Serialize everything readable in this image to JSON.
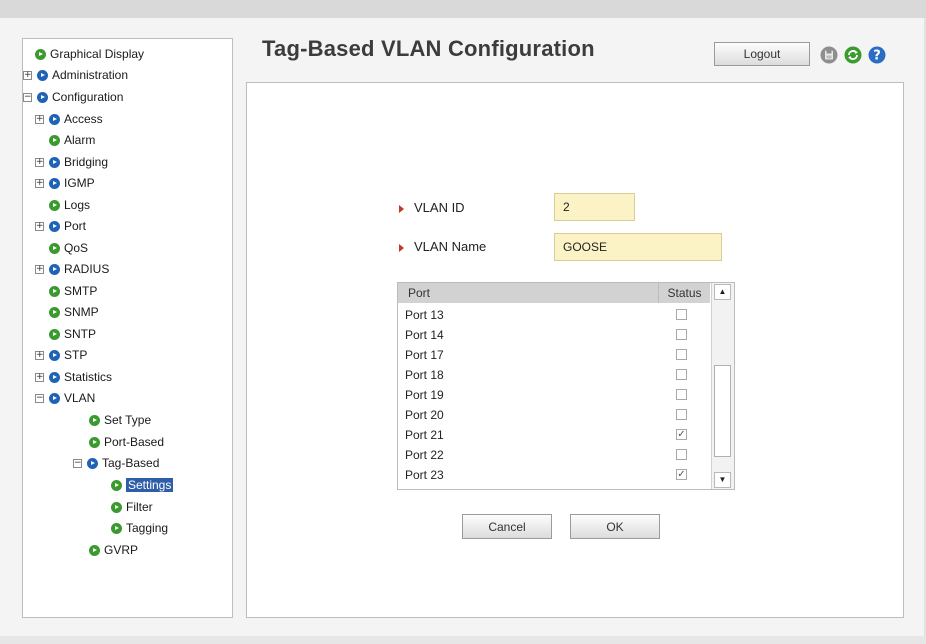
{
  "header": {
    "title": "Tag-Based VLAN Configuration",
    "logout_label": "Logout",
    "icons": [
      "save-icon",
      "refresh-icon",
      "help-icon"
    ]
  },
  "sidebar": {
    "items": [
      {
        "label": "Graphical Display"
      },
      {
        "label": "Administration",
        "expander": "+"
      },
      {
        "label": "Configuration",
        "expander": "−"
      },
      {
        "label": "Access",
        "expander": "+"
      },
      {
        "label": "Alarm"
      },
      {
        "label": "Bridging",
        "expander": "+"
      },
      {
        "label": "IGMP",
        "expander": "+"
      },
      {
        "label": "Logs"
      },
      {
        "label": "Port",
        "expander": "+"
      },
      {
        "label": "QoS"
      },
      {
        "label": "RADIUS",
        "expander": "+"
      },
      {
        "label": "SMTP"
      },
      {
        "label": "SNMP"
      },
      {
        "label": "SNTP"
      },
      {
        "label": "STP",
        "expander": "+"
      },
      {
        "label": "Statistics",
        "expander": "+"
      },
      {
        "label": "VLAN",
        "expander": "−"
      },
      {
        "label": "Set Type"
      },
      {
        "label": "Port-Based"
      },
      {
        "label": "Tag-Based",
        "expander": "−"
      },
      {
        "label": "Settings",
        "selected": true
      },
      {
        "label": "Filter"
      },
      {
        "label": "Tagging"
      },
      {
        "label": "GVRP"
      }
    ]
  },
  "form": {
    "vlan_id_label": "VLAN ID",
    "vlan_id_value": "2",
    "vlan_name_label": "VLAN Name",
    "vlan_name_value": "GOOSE"
  },
  "port_table": {
    "headers": {
      "port": "Port",
      "status": "Status"
    },
    "rows": [
      {
        "port": "Port 13",
        "checked": false
      },
      {
        "port": "Port 14",
        "checked": false
      },
      {
        "port": "Port 17",
        "checked": false
      },
      {
        "port": "Port 18",
        "checked": false
      },
      {
        "port": "Port 19",
        "checked": false
      },
      {
        "port": "Port 20",
        "checked": false
      },
      {
        "port": "Port 21",
        "checked": true
      },
      {
        "port": "Port 22",
        "checked": false
      },
      {
        "port": "Port 23",
        "checked": true
      }
    ]
  },
  "buttons": {
    "cancel_label": "Cancel",
    "ok_label": "OK"
  },
  "colors": {
    "input_bg": "#fbf3c6",
    "selected_bg": "#2f5ea9",
    "bullet_green": "#3a9a2e",
    "bullet_blue": "#1f63b6"
  }
}
